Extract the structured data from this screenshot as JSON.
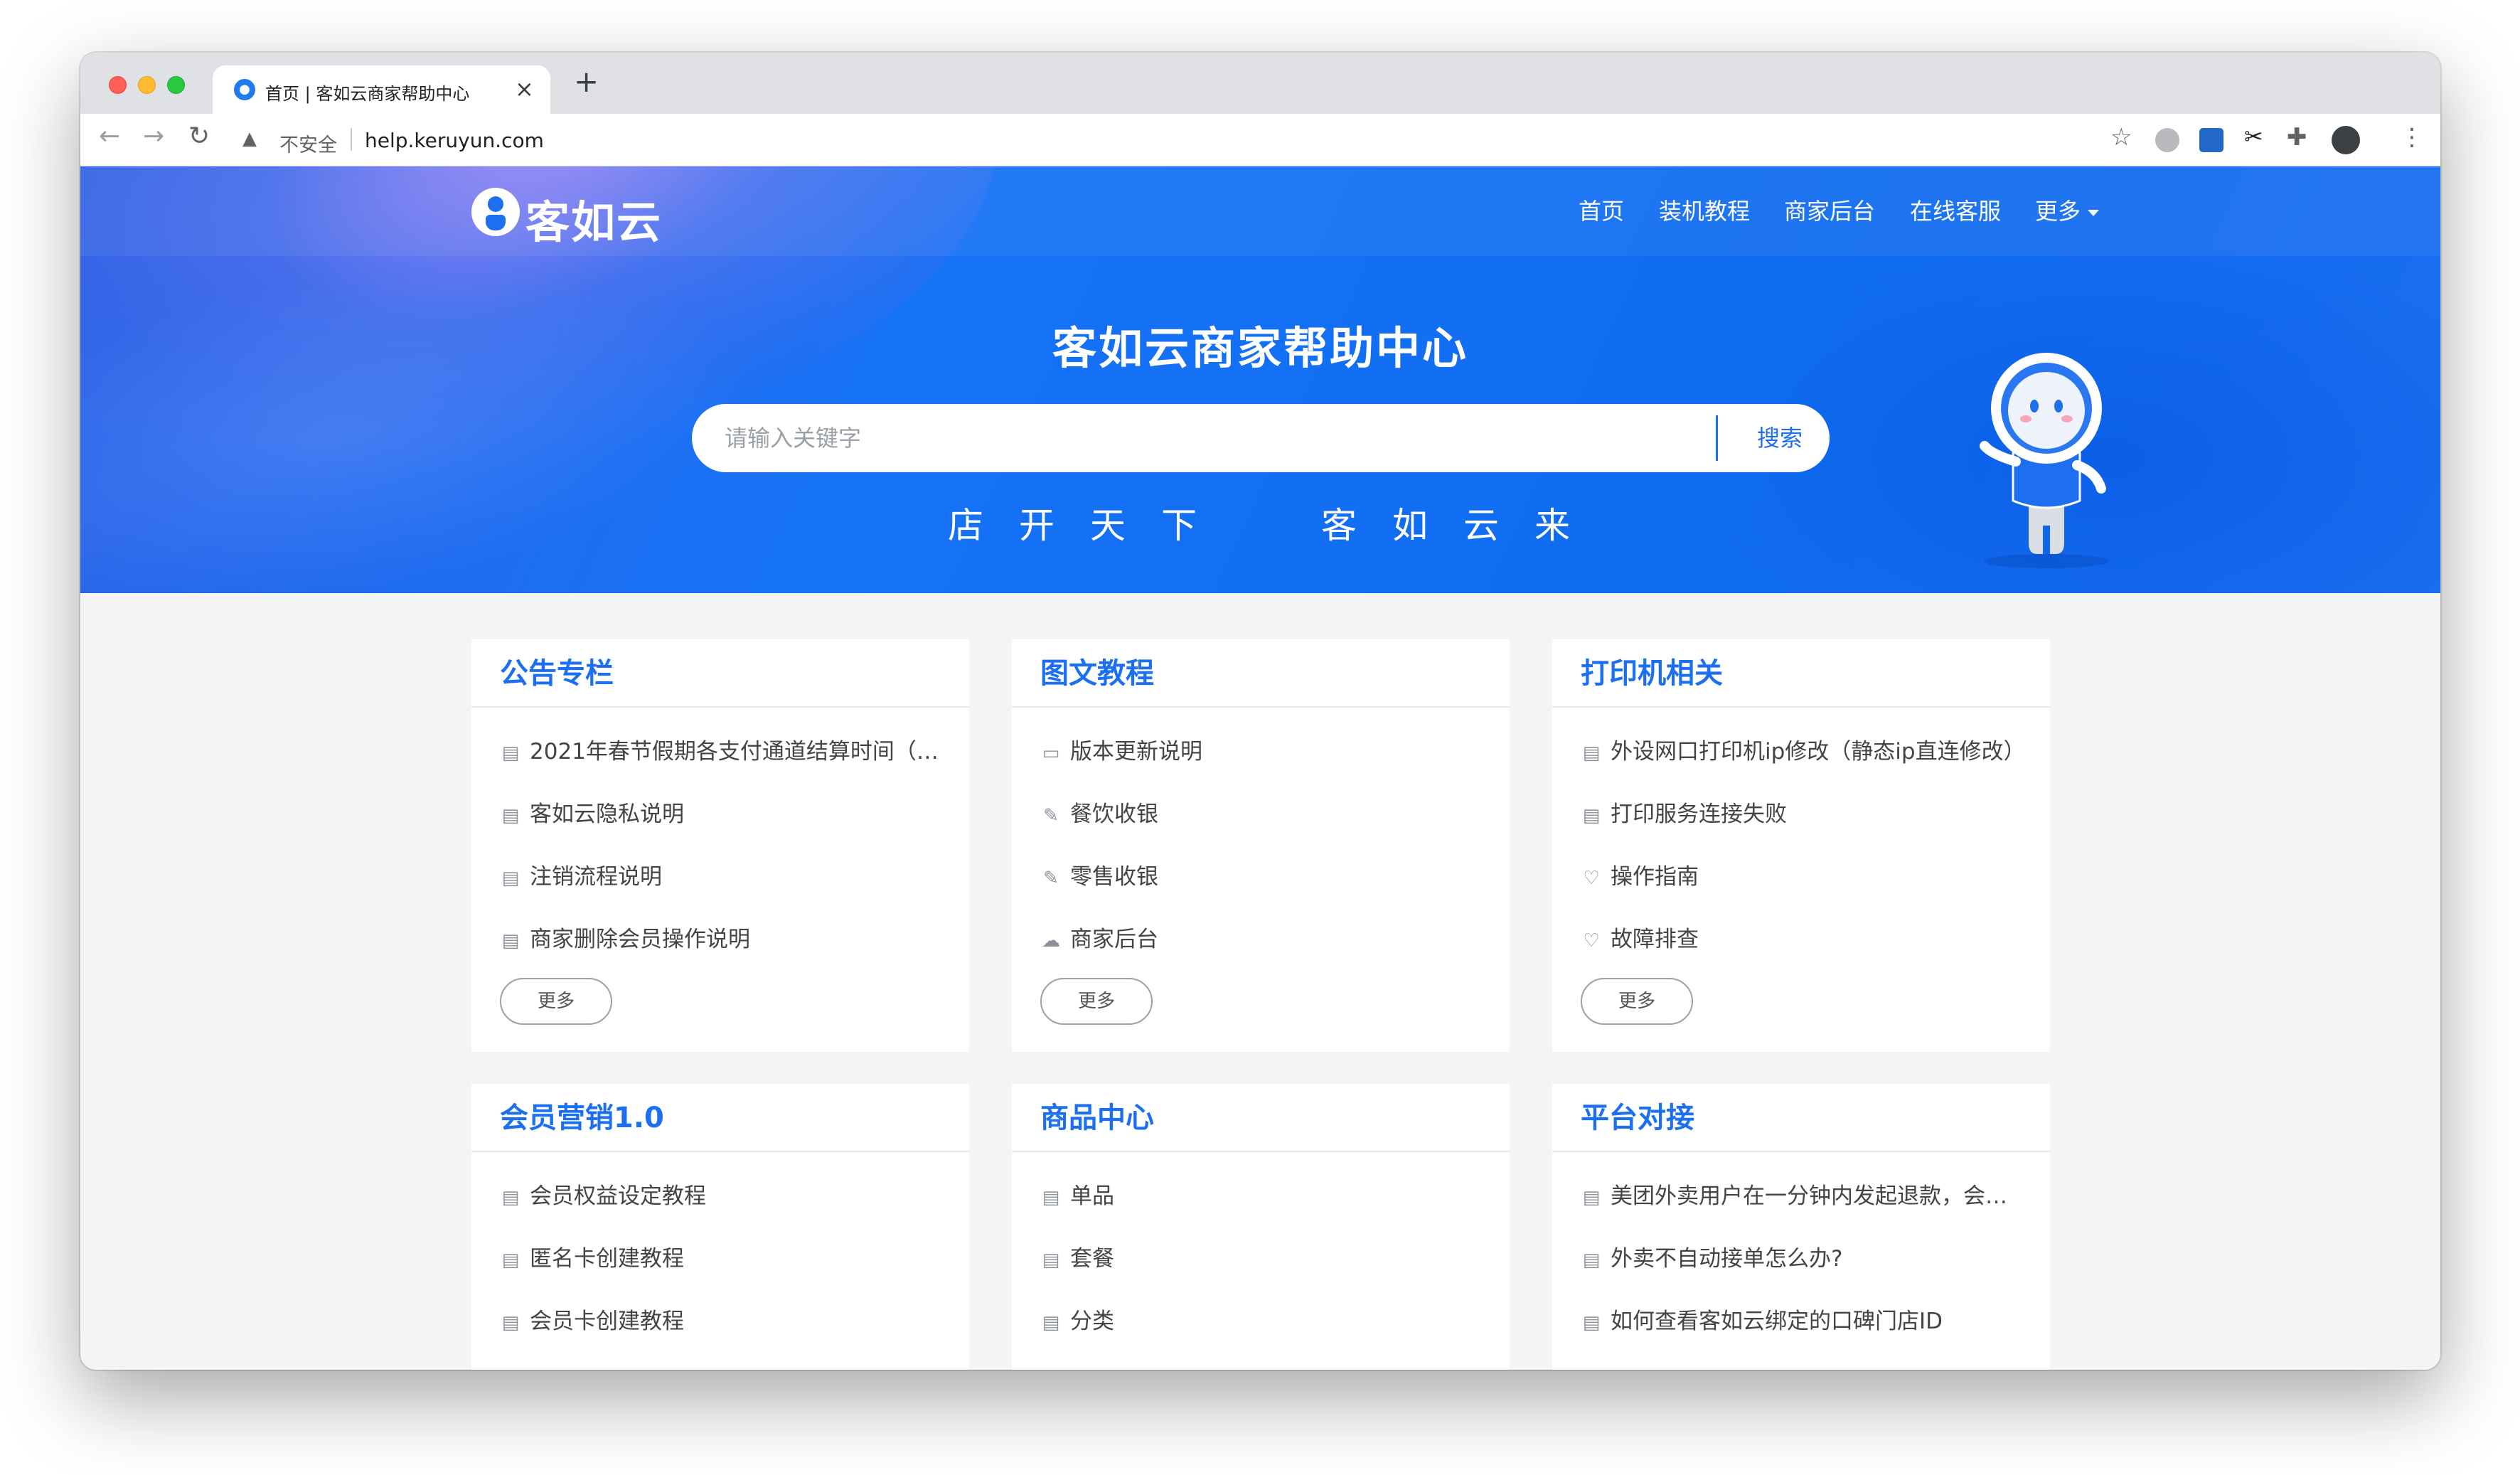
{
  "browser": {
    "tab_title": "首页 | 客如云商家帮助中心",
    "tab_close": "×",
    "new_tab": "+",
    "security_label": "不安全",
    "url": "help.keruyun.com",
    "icons": [
      "back-icon",
      "forward-icon",
      "reload-icon",
      "warning-icon",
      "star-icon",
      "extension-icon",
      "puzzle-icon",
      "profile-icon",
      "menu-icon"
    ]
  },
  "site": {
    "logo_text": "客如云",
    "nav": [
      "首页",
      "装机教程",
      "商家后台",
      "在线客服",
      "更多"
    ],
    "hero_title": "客如云商家帮助中心",
    "search_placeholder": "请输入关键字",
    "search_button": "搜索",
    "slogan_left": "店开天下",
    "slogan_right": "客如云来"
  },
  "cards": [
    {
      "title": "公告专栏",
      "items": [
        {
          "icon": "doc-icon",
          "text": "2021年春节假期各支付通道结算时间（2…"
        },
        {
          "icon": "doc-icon",
          "text": "客如云隐私说明"
        },
        {
          "icon": "doc-icon",
          "text": "注销流程说明"
        },
        {
          "icon": "doc-icon",
          "text": "商家删除会员操作说明"
        }
      ],
      "more": "更多"
    },
    {
      "title": "图文教程",
      "items": [
        {
          "icon": "folder-icon",
          "text": "版本更新说明"
        },
        {
          "icon": "edit-icon",
          "text": "餐饮收银"
        },
        {
          "icon": "edit-icon",
          "text": "零售收银"
        },
        {
          "icon": "cloud-icon",
          "text": "商家后台"
        }
      ],
      "more": "更多"
    },
    {
      "title": "打印机相关",
      "items": [
        {
          "icon": "doc-icon",
          "text": "外设网口打印机ip修改（静态ip直连修改）"
        },
        {
          "icon": "doc-icon",
          "text": "打印服务连接失败"
        },
        {
          "icon": "heartbeat-icon",
          "text": "操作指南"
        },
        {
          "icon": "heartbeat-icon",
          "text": "故障排查"
        }
      ],
      "more": "更多"
    },
    {
      "title": "会员营销1.0",
      "items": [
        {
          "icon": "doc-icon",
          "text": "会员权益设定教程"
        },
        {
          "icon": "doc-icon",
          "text": "匿名卡创建教程"
        },
        {
          "icon": "doc-icon",
          "text": "会员卡创建教程"
        }
      ]
    },
    {
      "title": "商品中心",
      "items": [
        {
          "icon": "doc-icon",
          "text": "单品"
        },
        {
          "icon": "doc-icon",
          "text": "套餐"
        },
        {
          "icon": "doc-icon",
          "text": "分类"
        }
      ]
    },
    {
      "title": "平台对接",
      "items": [
        {
          "icon": "doc-icon",
          "text": "美团外卖用户在一分钟内发起退款，会…"
        },
        {
          "icon": "doc-icon",
          "text": "外卖不自动接单怎么办?"
        },
        {
          "icon": "doc-icon",
          "text": "如何查看客如云绑定的口碑门店ID"
        }
      ]
    }
  ],
  "colors": {
    "brand_blue": "#1c6ff0",
    "hero_blue": "#1672f6",
    "page_bg": "#f3f4f6"
  }
}
